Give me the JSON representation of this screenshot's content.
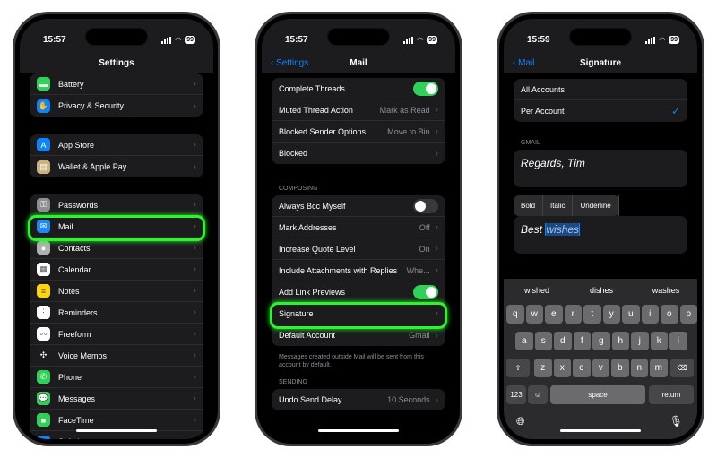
{
  "phones": [
    {
      "time": "15:57",
      "battery": "99",
      "title": "Settings",
      "groups": [
        [
          {
            "label": "Battery",
            "icon": "battery-icon",
            "color": "#30d158",
            "glyph": "▬"
          },
          {
            "label": "Privacy & Security",
            "icon": "hand-icon",
            "color": "#0a84ff",
            "glyph": "✋"
          }
        ],
        [
          {
            "label": "App Store",
            "icon": "app-store-icon",
            "color": "#0a84ff",
            "glyph": "A"
          },
          {
            "label": "Wallet & Apple Pay",
            "icon": "wallet-icon",
            "color": "#c9b27c",
            "glyph": "▤"
          }
        ],
        [
          {
            "label": "Passwords",
            "icon": "key-icon",
            "color": "#8e8e93",
            "glyph": "⚿"
          },
          {
            "label": "Mail",
            "icon": "mail-icon",
            "color": "#1e88f5",
            "glyph": "✉"
          },
          {
            "label": "Contacts",
            "icon": "contacts-icon",
            "color": "#b0b0b0",
            "glyph": "●"
          },
          {
            "label": "Calendar",
            "icon": "calendar-icon",
            "color": "#ffffff",
            "glyph": "▦"
          },
          {
            "label": "Notes",
            "icon": "notes-icon",
            "color": "#ffd60a",
            "glyph": "≡"
          },
          {
            "label": "Reminders",
            "icon": "reminders-icon",
            "color": "#ffffff",
            "glyph": "⋮"
          },
          {
            "label": "Freeform",
            "icon": "freeform-icon",
            "color": "#ffffff",
            "glyph": "〰"
          },
          {
            "label": "Voice Memos",
            "icon": "voice-memos-icon",
            "color": "#1c1c1e",
            "glyph": "✣"
          },
          {
            "label": "Phone",
            "icon": "phone-icon",
            "color": "#30d158",
            "glyph": "✆"
          },
          {
            "label": "Messages",
            "icon": "messages-icon",
            "color": "#30d158",
            "glyph": "💬"
          },
          {
            "label": "FaceTime",
            "icon": "facetime-icon",
            "color": "#30d158",
            "glyph": "■"
          },
          {
            "label": "Safari",
            "icon": "safari-icon",
            "color": "#0a84ff",
            "glyph": "⊕"
          }
        ]
      ]
    },
    {
      "time": "15:57",
      "battery": "99",
      "title": "Mail",
      "back": "Settings",
      "groups": [
        [
          {
            "label": "Complete Threads",
            "toggle": true
          },
          {
            "label": "Muted Thread Action",
            "value": "Mark as Read"
          },
          {
            "label": "Blocked Sender Options",
            "value": "Move to Bin"
          },
          {
            "label": "Blocked",
            "value": ""
          }
        ],
        [
          {
            "label": "Always Bcc Myself",
            "toggle": false
          },
          {
            "label": "Mark Addresses",
            "value": "Off"
          },
          {
            "label": "Increase Quote Level",
            "value": "On"
          },
          {
            "label": "Include Attachments with Replies",
            "value": "Whe..."
          },
          {
            "label": "Add Link Previews",
            "toggle": true
          },
          {
            "label": "Signature",
            "value": ""
          },
          {
            "label": "Default Account",
            "value": "Gmail"
          }
        ],
        [
          {
            "label": "Undo Send Delay",
            "value": "10 Seconds"
          }
        ]
      ],
      "composing": "COMPOSING",
      "footer": "Messages created outside Mail will be sent from this account by default.",
      "sending": "SENDING"
    },
    {
      "time": "15:59",
      "battery": "99",
      "title": "Signature",
      "back": "Mail",
      "options": [
        {
          "label": "All Accounts",
          "checked": false
        },
        {
          "label": "Per Account",
          "checked": true
        }
      ],
      "account": "GMAIL",
      "signature1": "Regards, Tim",
      "sig2_prefix": "Best ",
      "sig2_selected": "wishes",
      "format_menu": [
        "Bold",
        "Italic",
        "Underline"
      ],
      "suggestions": [
        "wished",
        "dishes",
        "washes"
      ],
      "keys": [
        [
          "q",
          "w",
          "e",
          "r",
          "t",
          "y",
          "u",
          "i",
          "o",
          "p"
        ],
        [
          "a",
          "s",
          "d",
          "f",
          "g",
          "h",
          "j",
          "k",
          "l"
        ],
        [
          "z",
          "x",
          "c",
          "v",
          "b",
          "n",
          "m"
        ]
      ],
      "key_123": "123",
      "key_space": "space",
      "key_return": "return"
    }
  ],
  "colors": {
    "accent": "#0a84ff",
    "highlight": "#2bf52b",
    "toggle_on": "#30d158"
  }
}
